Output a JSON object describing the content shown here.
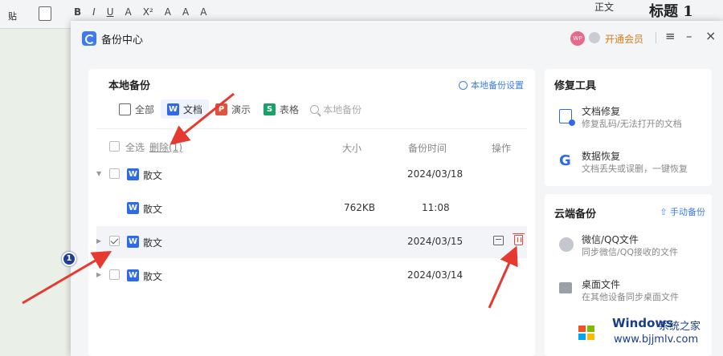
{
  "background_app": {
    "paste_label": "贴",
    "format_buttons": [
      "B",
      "I",
      "U",
      "A",
      "X²",
      "A",
      "A",
      "A"
    ],
    "style_normal": "正文",
    "style_heading": "标题 1"
  },
  "dialog": {
    "title": "备份中心",
    "avatar_text": "WP",
    "vip_label": "开通会员"
  },
  "local_backup": {
    "title": "本地备份",
    "settings_label": "本地备份设置",
    "filters": [
      {
        "label": "全部",
        "icon": "grid-icon",
        "glyph": "▦"
      },
      {
        "label": "文档",
        "icon": "word-icon",
        "glyph": "W"
      },
      {
        "label": "演示",
        "icon": "ppt-icon",
        "glyph": "P"
      },
      {
        "label": "表格",
        "icon": "sheet-icon",
        "glyph": "S"
      }
    ],
    "search_placeholder": "本地备份",
    "columns": {
      "select_all": "全选",
      "delete": "删除(1)",
      "size": "大小",
      "time": "备份时间",
      "action": "操作"
    },
    "rows": [
      {
        "name": "散文",
        "size": "",
        "time": "2024/03/18",
        "expanded": true,
        "checked": false
      },
      {
        "name": "散文",
        "size": "762KB",
        "time": "11:08",
        "child": true
      },
      {
        "name": "散文",
        "size": "",
        "time": "2024/03/15",
        "expanded": false,
        "checked": true,
        "highlighted": true
      },
      {
        "name": "散文",
        "size": "",
        "time": "2024/03/14",
        "expanded": false,
        "checked": false
      }
    ]
  },
  "repair_tools": {
    "title": "修复工具",
    "items": [
      {
        "name": "文档修复",
        "desc": "修复乱码/无法打开的文档",
        "icon": "doc-repair-icon"
      },
      {
        "name": "数据恢复",
        "desc": "文档丢失或误删，一键恢复",
        "icon": "data-recovery-icon",
        "glyph": "G"
      }
    ]
  },
  "cloud_backup": {
    "title": "云端备份",
    "manual_label": "手动备份",
    "items": [
      {
        "name": "微信/QQ文件",
        "desc": "同步微信/QQ接收的文件",
        "icon": "wechat-qq-icon"
      },
      {
        "name": "桌面文件",
        "desc": "在其他设备同步桌面文件",
        "icon": "desktop-icon"
      }
    ]
  },
  "annotation": {
    "step": "1"
  },
  "watermark": {
    "title": "Windows",
    "site": "系统之家",
    "url": "www.bjjmlv.com"
  },
  "colors": {
    "accent": "#3d7cf0",
    "word": "#2f6ae6",
    "ppt": "#e0543d",
    "sheet": "#1aa168",
    "arrow": "#e53a2f",
    "delete": "#e04a3c"
  }
}
